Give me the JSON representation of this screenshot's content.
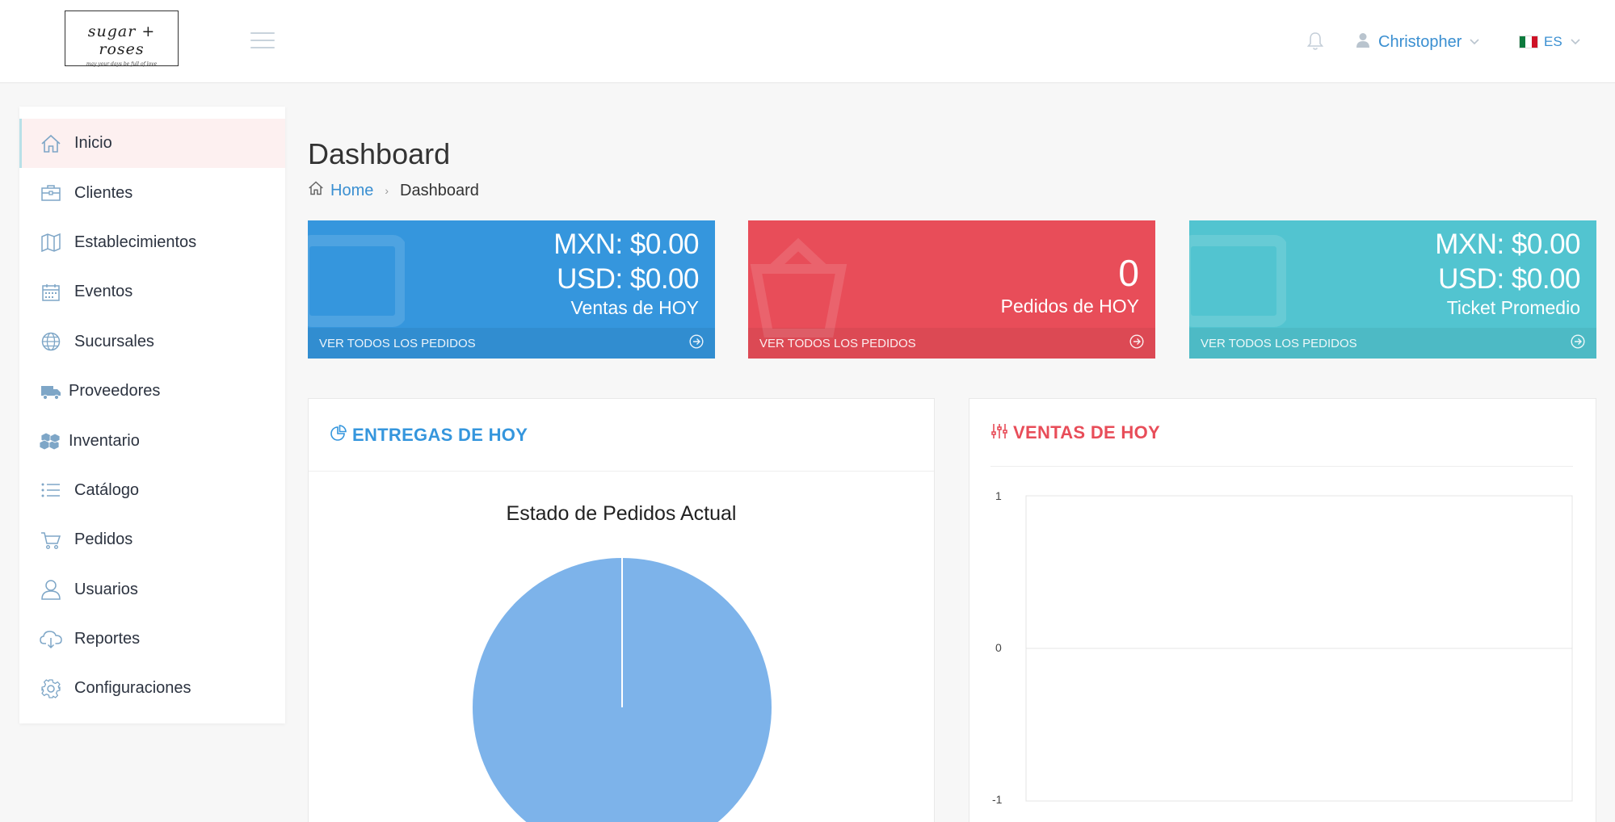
{
  "header": {
    "logo_text": "sugar + roses",
    "logo_tagline": "may your days be full of love",
    "user_name": "Christopher",
    "language": "ES"
  },
  "sidebar": {
    "items": [
      {
        "label": "Inicio",
        "icon": "home-icon"
      },
      {
        "label": "Clientes",
        "icon": "briefcase-icon"
      },
      {
        "label": "Establecimientos",
        "icon": "map-icon"
      },
      {
        "label": "Eventos",
        "icon": "calendar-icon"
      },
      {
        "label": "Sucursales",
        "icon": "globe-icon"
      },
      {
        "label": "Proveedores",
        "icon": "truck-icon"
      },
      {
        "label": "Inventario",
        "icon": "cubes-icon"
      },
      {
        "label": "Catálogo",
        "icon": "list-icon"
      },
      {
        "label": "Pedidos",
        "icon": "cart-icon"
      },
      {
        "label": "Usuarios",
        "icon": "user-icon"
      },
      {
        "label": "Reportes",
        "icon": "cloud-download-icon"
      },
      {
        "label": "Configuraciones",
        "icon": "gear-icon"
      }
    ]
  },
  "page": {
    "title": "Dashboard",
    "breadcrumb_home": "Home",
    "breadcrumb_current": "Dashboard"
  },
  "stats": [
    {
      "line1": "MXN: $0.00",
      "line2": "USD: $0.00",
      "label": "Ventas de HOY",
      "footer": "VER TODOS LOS PEDIDOS",
      "color": "#3596dd"
    },
    {
      "big": "0",
      "label": "Pedidos de HOY",
      "footer": "VER TODOS LOS PEDIDOS",
      "color": "#e84d59"
    },
    {
      "line1": "MXN: $0.00",
      "line2": "USD: $0.00",
      "label": "Ticket Promedio",
      "footer": "VER TODOS LOS PEDIDOS",
      "color": "#52c4d0"
    }
  ],
  "panels": {
    "deliveries_title": "ENTREGAS DE HOY",
    "deliveries_color": "#3596dd",
    "sales_title": "VENTAS DE HOY",
    "sales_color": "#e84d59"
  },
  "chart_data": [
    {
      "type": "pie",
      "title": "Estado de Pedidos Actual",
      "slices": [
        {
          "value": 100
        }
      ],
      "color": "#7db3ea"
    },
    {
      "type": "line",
      "y_ticks": [
        "1",
        "0",
        "-1"
      ],
      "ylim": [
        -1,
        1
      ],
      "series": []
    }
  ]
}
